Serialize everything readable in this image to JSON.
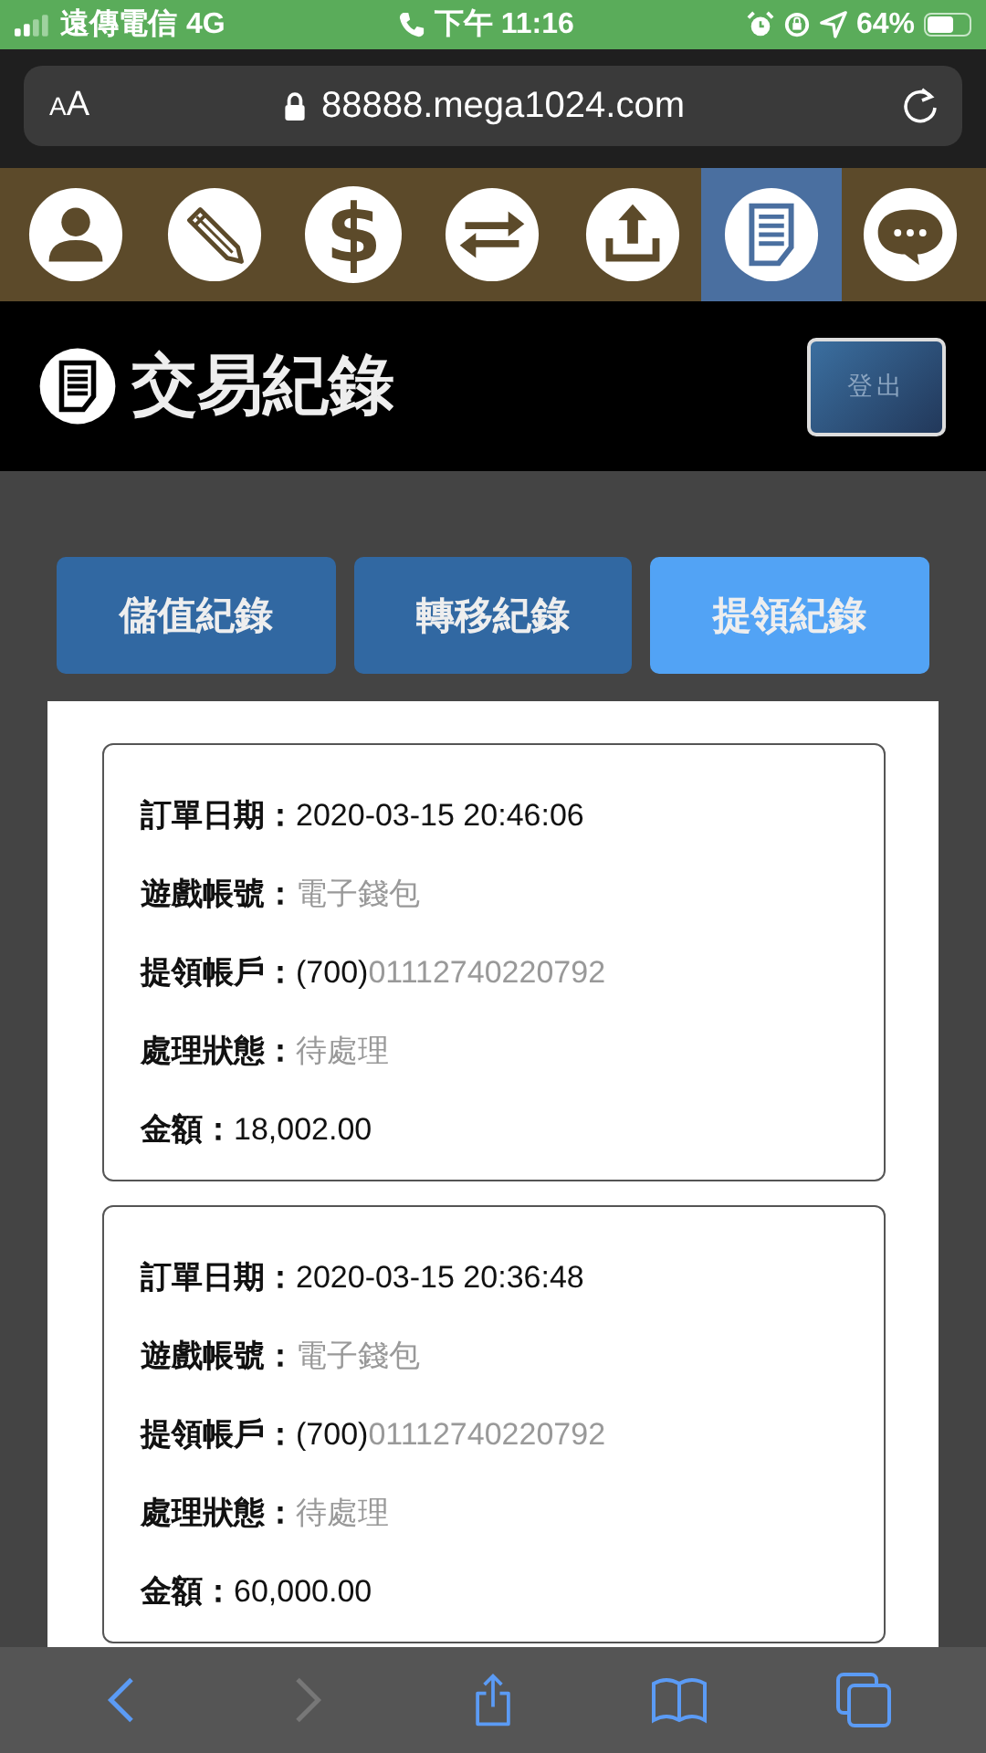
{
  "status_bar": {
    "carrier": "遠傳電信",
    "network": "4G",
    "time": "下午 11:16",
    "battery": "64%"
  },
  "browser": {
    "text_size": "AA",
    "url": "88888.mega1024.com"
  },
  "nav": [
    {
      "kind": "person",
      "selected": false
    },
    {
      "kind": "pencil",
      "selected": false
    },
    {
      "kind": "dollar",
      "glyph": "$",
      "selected": false
    },
    {
      "kind": "swap",
      "selected": false
    },
    {
      "kind": "upload",
      "selected": false
    },
    {
      "kind": "document",
      "selected": true
    },
    {
      "kind": "chat",
      "selected": false
    }
  ],
  "header": {
    "title": "交易紀錄",
    "logout": "登出"
  },
  "tabs": [
    {
      "label": "儲值紀錄",
      "selected": false
    },
    {
      "label": "轉移紀錄",
      "selected": false
    },
    {
      "label": "提領紀錄",
      "selected": true
    }
  ],
  "records": [
    {
      "fields": [
        {
          "label": "訂單日期：",
          "parts": [
            {
              "text": "2020-03-15 20:46:06",
              "muted": false
            }
          ]
        },
        {
          "label": "遊戲帳號：",
          "parts": [
            {
              "text": "電子錢包",
              "muted": true
            }
          ]
        },
        {
          "label": "提領帳戶：",
          "parts": [
            {
              "text": "(700)",
              "muted": false
            },
            {
              "text": "01112740220792",
              "muted": true
            }
          ]
        },
        {
          "label": "處理狀態：",
          "parts": [
            {
              "text": "待處理",
              "muted": true
            }
          ]
        },
        {
          "label": "金額：",
          "parts": [
            {
              "text": "18,002.00",
              "muted": false
            }
          ]
        }
      ]
    },
    {
      "fields": [
        {
          "label": "訂單日期：",
          "parts": [
            {
              "text": "2020-03-15 20:36:48",
              "muted": false
            }
          ]
        },
        {
          "label": "遊戲帳號：",
          "parts": [
            {
              "text": "電子錢包",
              "muted": true
            }
          ]
        },
        {
          "label": "提領帳戶：",
          "parts": [
            {
              "text": "(700)",
              "muted": false
            },
            {
              "text": "01112740220792",
              "muted": true
            }
          ]
        },
        {
          "label": "處理狀態：",
          "parts": [
            {
              "text": "待處理",
              "muted": true
            }
          ]
        },
        {
          "label": "金額：",
          "parts": [
            {
              "text": "60,000.00",
              "muted": false
            }
          ]
        }
      ]
    }
  ]
}
